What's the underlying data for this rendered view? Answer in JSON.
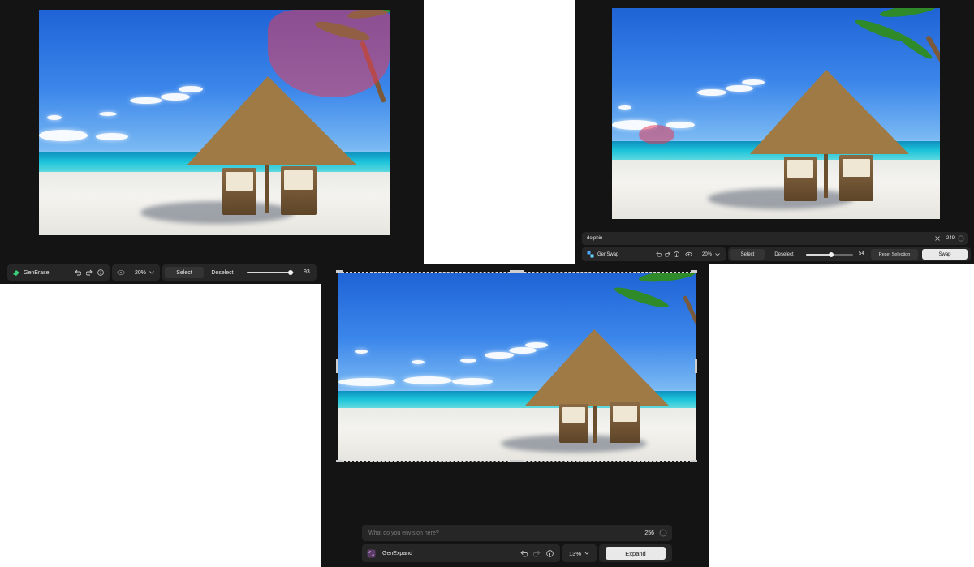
{
  "panels": {
    "generase": {
      "tool_name": "GenErase",
      "tool_icon": "eraser-icon",
      "zoom": "20%",
      "select_label": "Select",
      "deselect_label": "Deselect",
      "brush_size": "93",
      "brush_level": 0.93
    },
    "genswap": {
      "prompt_value": "dolphin",
      "char_count": "249",
      "tool_name": "GenSwap",
      "tool_icon": "swap-icon",
      "zoom": "20%",
      "select_label": "Select",
      "deselect_label": "Deselect",
      "brush_size": "54",
      "brush_level": 0.54,
      "reset_label": "Reset Selection",
      "action_label": "Swap"
    },
    "genexpand": {
      "prompt_placeholder": "What do you envision here?",
      "char_count": "256",
      "tool_name": "GenExpand",
      "tool_icon": "expand-icon",
      "zoom": "13%",
      "action_label": "Expand"
    }
  },
  "colors": {
    "panel_bg": "#141414",
    "toolbar_bg": "#262626",
    "mask": "#e63c5a",
    "primary_button": "#e9e9e9"
  }
}
